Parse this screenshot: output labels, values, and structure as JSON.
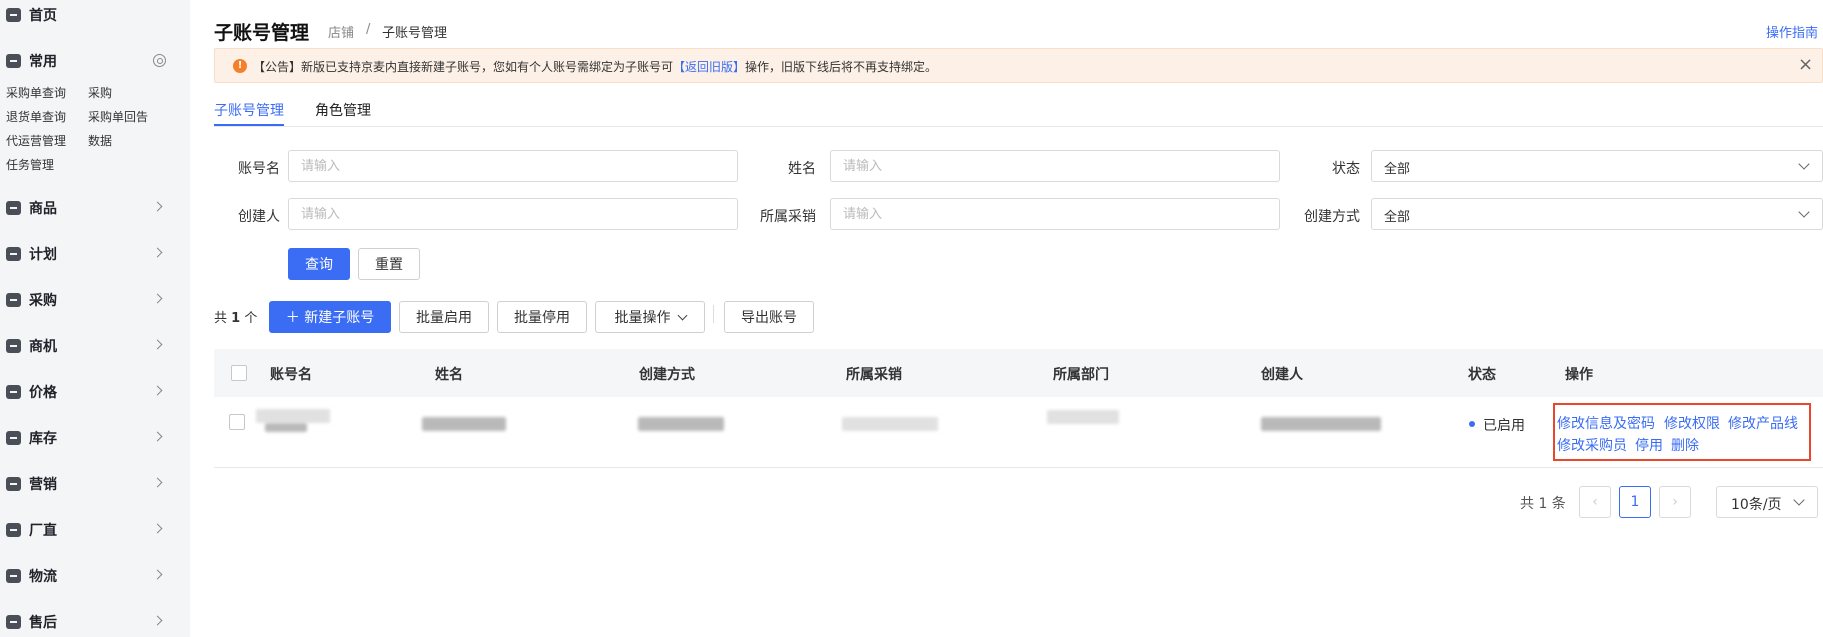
{
  "sidebar": {
    "home": "首页",
    "common": "常用",
    "quick_links": [
      "采购单查询",
      "采购",
      "退货单查询",
      "采购单回告",
      "代运营管理",
      "数据",
      "任务管理"
    ],
    "menu": [
      "商品",
      "计划",
      "采购",
      "商机",
      "价格",
      "库存",
      "营销",
      "厂直",
      "物流",
      "售后"
    ]
  },
  "header": {
    "title": "子账号管理",
    "breadcrumb": [
      "店铺",
      "/",
      "子账号管理"
    ],
    "guide": "操作指南"
  },
  "notice": {
    "icon": "!",
    "text_before": "【公告】新版已支持京麦内直接新建子账号，您如有个人账号需绑定为子账号可",
    "link": "【返回旧版】",
    "text_after": "操作，旧版下线后将不再支持绑定。",
    "close": "×"
  },
  "tabs": [
    "子账号管理",
    "角色管理"
  ],
  "filters": {
    "account_label": "账号名",
    "name_label": "姓名",
    "status_label": "状态",
    "creator_label": "创建人",
    "buyer_label": "所属采销",
    "method_label": "创建方式",
    "placeholder": "请输入",
    "status_value": "全部",
    "method_value": "全部",
    "query": "查询",
    "reset": "重置"
  },
  "actions": {
    "total_prefix": "共",
    "total_count": "1",
    "total_suffix": "个",
    "new_account": "＋ 新建子账号",
    "batch_enable": "批量启用",
    "batch_disable": "批量停用",
    "batch_ops": "批量操作",
    "export": "导出账号"
  },
  "table": {
    "columns": [
      "账号名",
      "姓名",
      "创建方式",
      "所属采销",
      "所属部门",
      "创建人",
      "状态",
      "操作"
    ],
    "row": {
      "status": "已启用",
      "ops": [
        "修改信息及密码",
        "修改权限",
        "修改产品线",
        "修改采购员",
        "停用",
        "删除"
      ]
    }
  },
  "pagination": {
    "total": "共 1 条",
    "prev": "‹",
    "page": "1",
    "next": "›",
    "page_size": "10条/页"
  },
  "colors": {
    "accent": "#3a6cf4",
    "notice_bg": "#fdf1e7",
    "notice_icon": "#f5802a",
    "highlight_border": "#e8472c"
  }
}
